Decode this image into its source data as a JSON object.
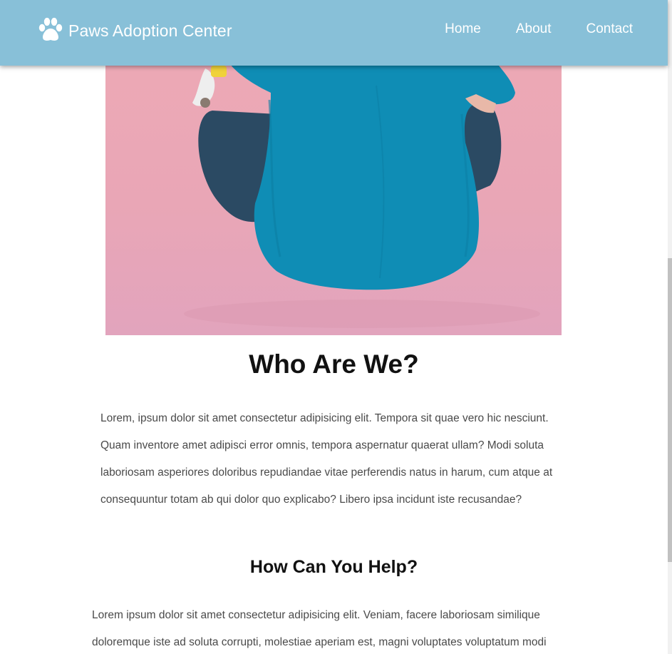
{
  "header": {
    "brand": "Paws Adoption Center",
    "brand_icon": "paw-icon",
    "nav": [
      {
        "label": "Home"
      },
      {
        "label": "About"
      },
      {
        "label": "Contact"
      }
    ],
    "background": "#88c0d8"
  },
  "hero": {
    "alt": "person in teal t-shirt sitting on pink floor holding a cat"
  },
  "about": {
    "title": "Who Are We?",
    "text": "Lorem, ipsum dolor sit amet consectetur adipisicing elit. Tempora sit quae vero hic nesciunt. Quam inventore amet adipisci error omnis, tempora aspernatur quaerat ullam? Modi soluta laboriosam asperiores doloribus repudiandae vitae perferendis natus in harum, cum atque at consequuntur totam ab qui dolor quo explicabo? Libero ipsa incidunt iste recusandae?"
  },
  "help": {
    "title": "How Can You Help?",
    "text": "Lorem ipsum dolor sit amet consectetur adipisicing elit. Veniam, facere laboriosam similique doloremque iste ad soluta corrupti, molestiae aperiam est, magni voluptates voluptatum modi"
  }
}
